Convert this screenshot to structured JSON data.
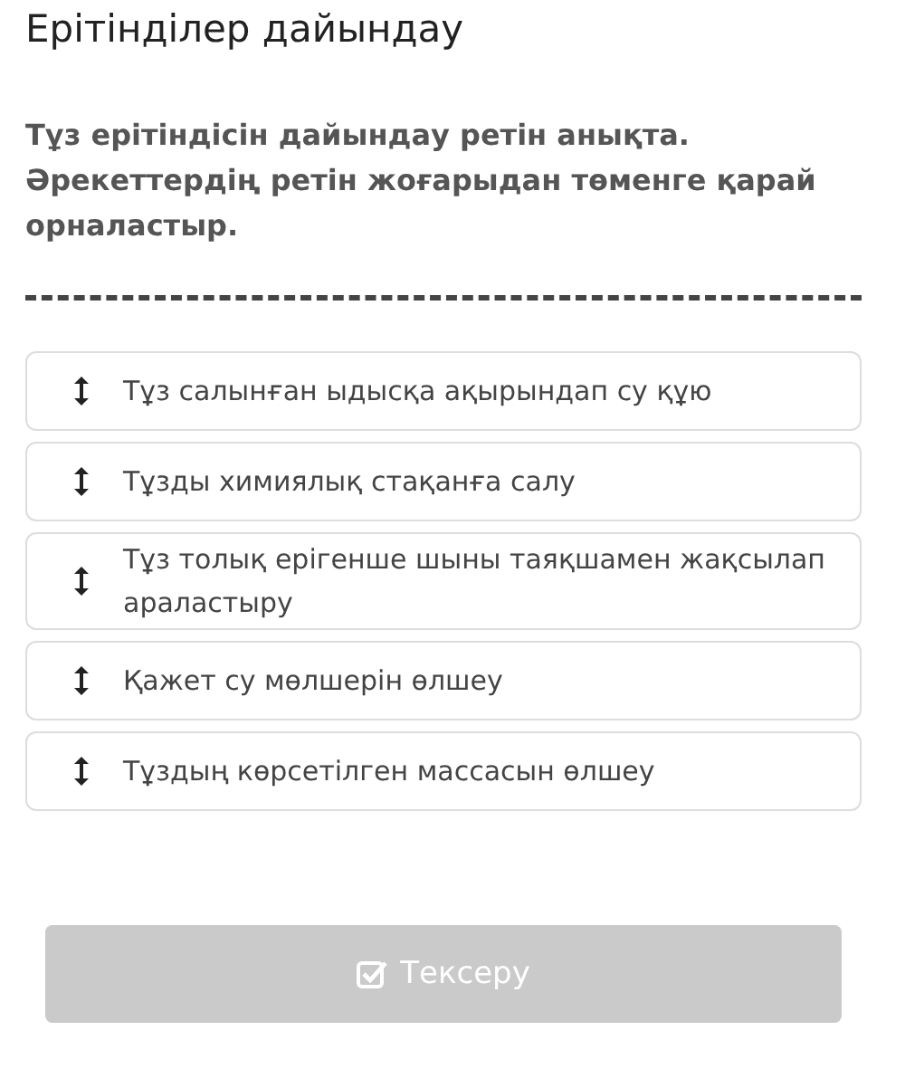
{
  "title": "Ерітінділер дайындау",
  "question": "Тұз ерітіндісін дайындау ретін анықта. Әрекеттердің ретін жоғарыдан төменге қарай орналастыр.",
  "items": [
    {
      "text": "Тұз салынған ыдысқа ақырындап су құю"
    },
    {
      "text": "Тұзды химиялық стақанға салу"
    },
    {
      "text": "Тұз толық ерігенше шыны таяқшамен жақсылап араластыру"
    },
    {
      "text": "Қажет су мөлшерін өлшеу"
    },
    {
      "text": "Тұздың көрсетілген массасын өлшеу"
    }
  ],
  "check_button": {
    "label": "Тексеру",
    "disabled": true
  }
}
